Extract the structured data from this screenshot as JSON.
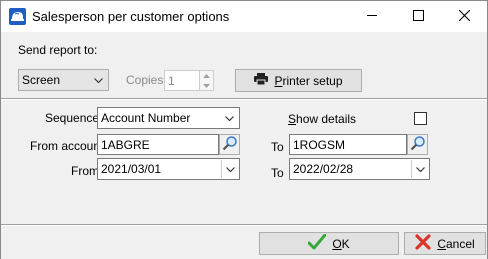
{
  "window": {
    "title": "Salesperson per customer options",
    "icon": "app-helmet-icon",
    "caption_buttons": [
      "minimize-icon",
      "maximize-icon",
      "close-icon"
    ]
  },
  "output": {
    "send_label": "Send report to:",
    "destination_value": "Screen",
    "copies_label": "Copies:",
    "copies_value": "1",
    "printer_setup_label": "Printer setup",
    "printer_icon": "printer-icon"
  },
  "options": {
    "sequence_label": "Sequence",
    "sequence_value": "Account Number",
    "from_account_label": "From account",
    "from_account_value": "1ABGRE",
    "to_account_label": "To",
    "to_account_value": "1ROGSM",
    "from_date_label": "From",
    "from_date_value": "2021/03/01",
    "to_date_label": "To",
    "to_date_value": "2022/02/28",
    "show_details_label": "Show details",
    "show_details_checked": false
  },
  "actions": {
    "ok_label": "OK",
    "cancel_label": "Cancel"
  },
  "colors": {
    "background": "#f0f0f0",
    "ok_check": "#3aa63a",
    "cancel_x": "#d9342b"
  }
}
